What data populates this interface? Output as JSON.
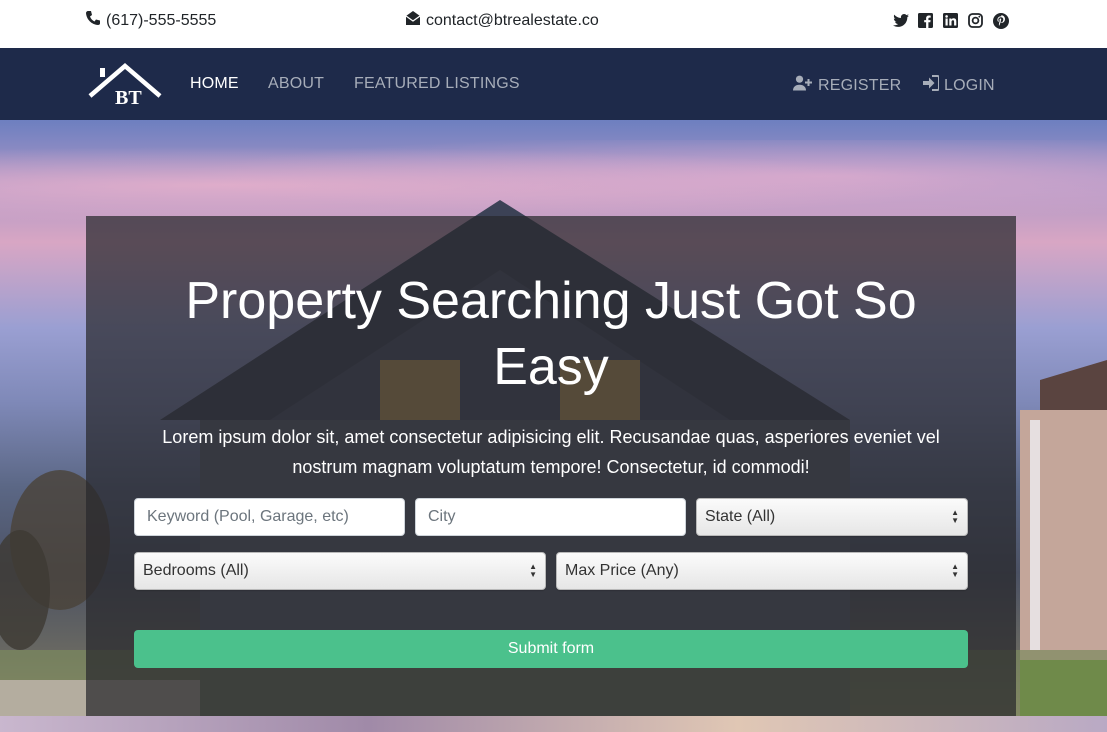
{
  "topbar": {
    "phone": "(617)-555-5555",
    "email": "contact@btrealestate.co",
    "social_icons": [
      "twitter-icon",
      "facebook-icon",
      "linkedin-icon",
      "instagram-icon",
      "pinterest-icon"
    ]
  },
  "navbar": {
    "logo_text": "BT",
    "links": [
      {
        "label": "HOME",
        "active": true
      },
      {
        "label": "ABOUT",
        "active": false
      },
      {
        "label": "FEATURED LISTINGS",
        "active": false
      }
    ],
    "register_label": "REGISTER",
    "login_label": "LOGIN"
  },
  "hero": {
    "title": "Property Searching Just Got So Easy",
    "lead": "Lorem ipsum dolor sit, amet consectetur adipisicing elit. Recusandae quas, asperiores eveniet vel nostrum magnam voluptatum tempore! Consectetur, id commodi!"
  },
  "search_form": {
    "keyword_placeholder": "Keyword (Pool, Garage, etc)",
    "city_placeholder": "City",
    "state_selected": "State (All)",
    "bedrooms_selected": "Bedrooms (All)",
    "max_price_selected": "Max Price (Any)",
    "submit_label": "Submit form"
  },
  "colors": {
    "navbar_bg": "#1e2a4a",
    "submit_bg": "#4bc18c",
    "nav_inactive": "#a7adb9",
    "nav_active": "#ffffff"
  }
}
